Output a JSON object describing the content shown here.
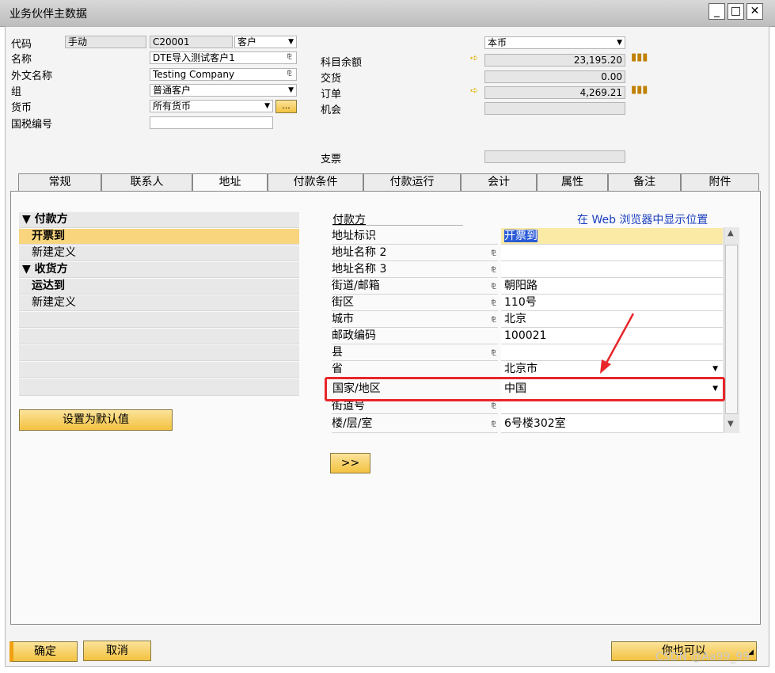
{
  "window": {
    "title": "业务伙伴主数据"
  },
  "header": {
    "code_label": "代码",
    "code_mode": "手动",
    "code_value": "C20001",
    "type_value": "客户",
    "name_label": "名称",
    "name_value": "DTE导入测试客户1",
    "foreign_name_label": "外文名称",
    "foreign_name_value": "Testing Company",
    "group_label": "组",
    "group_value": "普通客户",
    "currency_label": "货币",
    "currency_value": "所有货币",
    "currency_btn": "...",
    "tax_label": "国税编号",
    "tax_value": "",
    "balance_currency": "本币",
    "account_balance_label": "科目余额",
    "account_balance_value": "23,195.20",
    "delivery_label": "交货",
    "delivery_value": "0.00",
    "orders_label": "订单",
    "orders_value": "4,269.21",
    "opportunity_label": "机会",
    "cheque_label": "支票"
  },
  "tabs": [
    "常规",
    "联系人",
    "地址",
    "付款条件",
    "付款运行",
    "会计",
    "属性",
    "备注",
    "附件"
  ],
  "tree": {
    "payer_header": "付款方",
    "bill_to": "开票到",
    "payer_new": "新建定义",
    "shipper_header": "收货方",
    "ship_to": "运达到",
    "ship_new": "新建定义"
  },
  "set_default_button": "设置为默认值",
  "address": {
    "section_title": "付款方",
    "web_link": "在 Web 浏览器中显示位置",
    "rows": [
      {
        "label": "地址标识",
        "value": "开票到"
      },
      {
        "label": "地址名称 2",
        "value": ""
      },
      {
        "label": "地址名称 3",
        "value": ""
      },
      {
        "label": "街道/邮箱",
        "value": "朝阳路"
      },
      {
        "label": "街区",
        "value": "110号"
      },
      {
        "label": "城市",
        "value": "北京"
      },
      {
        "label": "邮政编码",
        "value": "100021"
      },
      {
        "label": "县",
        "value": ""
      },
      {
        "label": "省",
        "value": "北京市"
      },
      {
        "label": "国家/地区",
        "value": "中国"
      },
      {
        "label": "街道号",
        "value": ""
      },
      {
        "label": "楼/层/室",
        "value": "6号楼302室"
      }
    ],
    "next_button": ">>"
  },
  "footer": {
    "ok_button": "确定",
    "cancel_button": "取消",
    "also_button": "你也可以",
    "watermark": "CSDN @Aa99_99"
  },
  "colors": {
    "highlight": "#e8262a",
    "accent": "#f3c240",
    "selected_row": "#f9d57e"
  }
}
